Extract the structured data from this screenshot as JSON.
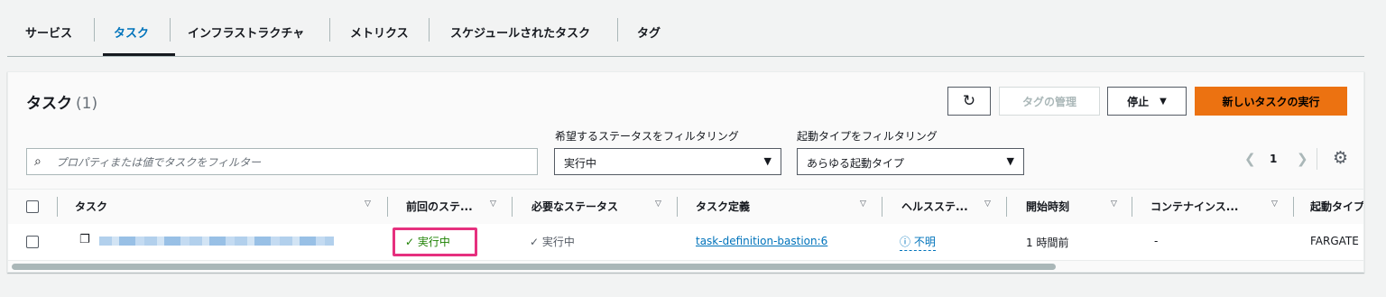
{
  "tabs": [
    "サービス",
    "タスク",
    "インフラストラクチャ",
    "メトリクス",
    "スケジュールされたタスク",
    "タグ"
  ],
  "active_tab": "タスク",
  "panel": {
    "title": "タスク",
    "count": "(1)",
    "buttons": {
      "refresh_icon": "refresh-icon",
      "manage_tags": "タグの管理",
      "stop": "停止",
      "run_task": "新しいタスクの実行"
    },
    "filters": {
      "search_placeholder": "プロパティまたは値でタスクをフィルター",
      "desired_status_label": "希望するステータスをフィルタリング",
      "desired_status_value": "実行中",
      "launch_type_label": "起動タイプをフィルタリング",
      "launch_type_value": "あらゆる起動タイプ"
    },
    "pagination": {
      "page": "1"
    }
  },
  "table": {
    "columns": [
      "タスク",
      "前回のステ...",
      "必要なステータス",
      "タスク定義",
      "ヘルスステ...",
      "開始時刻",
      "コンテナインス...",
      "起動タイプ"
    ],
    "rows": [
      {
        "last_status": "実行中",
        "desired_status": "実行中",
        "task_definition": "task-definition-bastion:6",
        "health_status": "不明",
        "started_at": "1 時間前",
        "container_instance": "-",
        "launch_type": "FARGATE"
      }
    ]
  },
  "colors": {
    "accent": "#0073bb",
    "primary_button": "#ec7211",
    "success": "#1d8102",
    "highlight": "#e6307e"
  }
}
